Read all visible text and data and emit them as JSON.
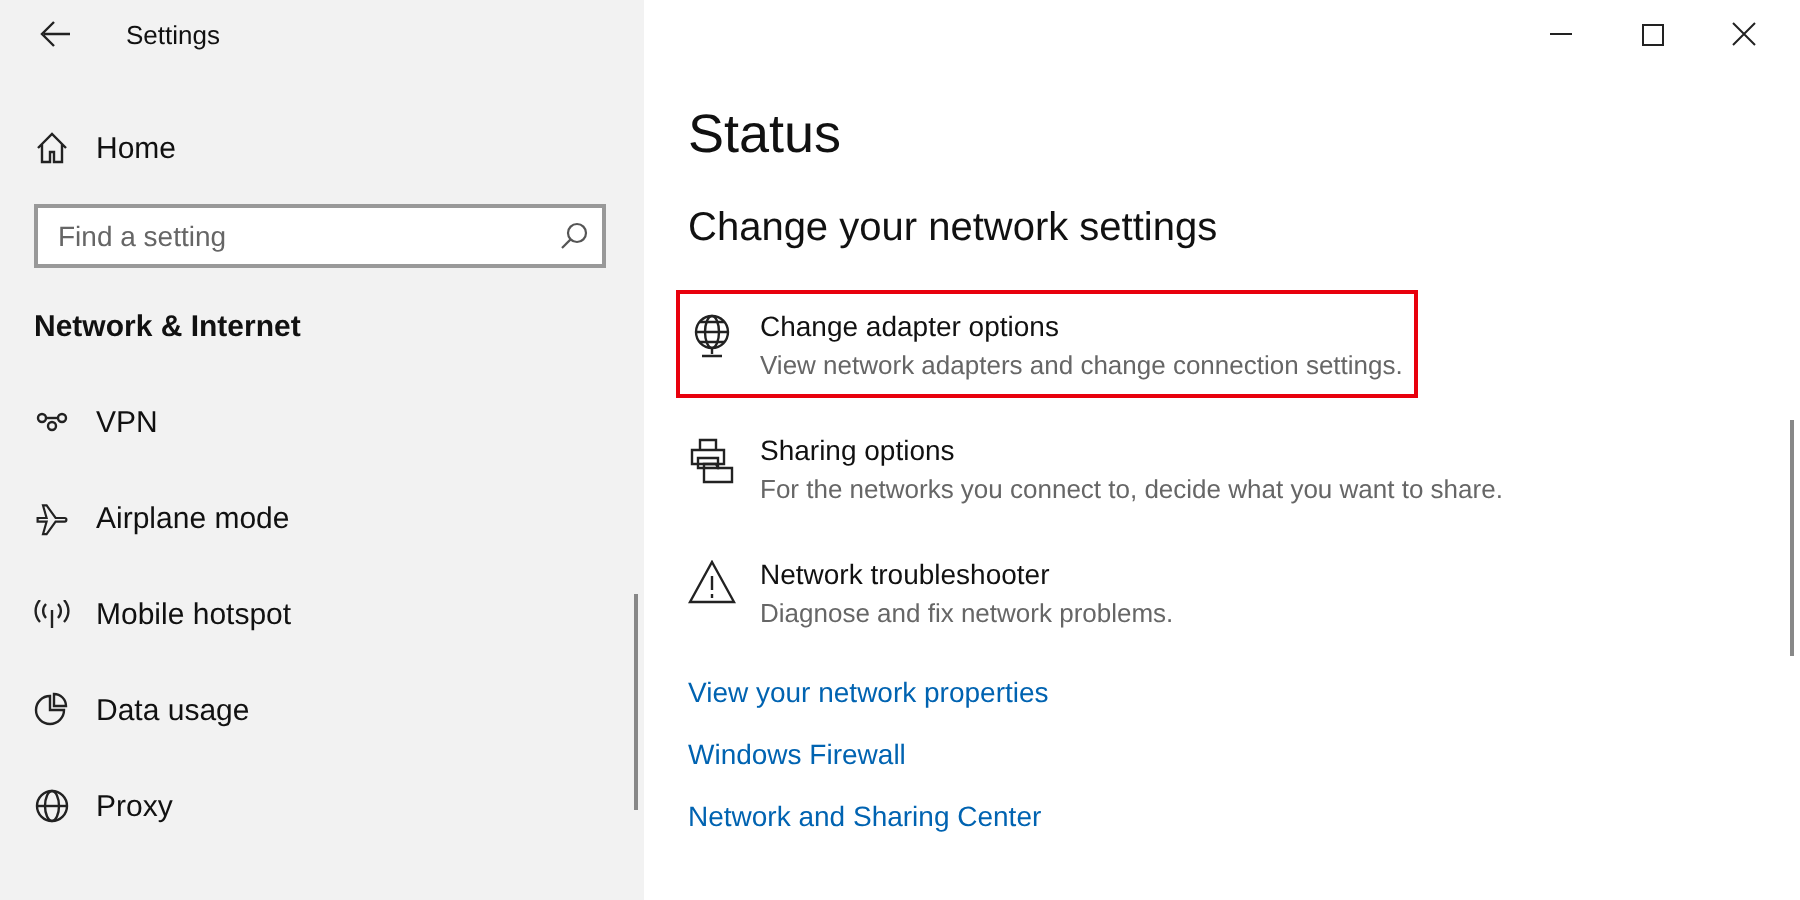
{
  "window": {
    "title": "Settings"
  },
  "sidebar": {
    "home": "Home",
    "search": {
      "placeholder": "Find a setting"
    },
    "section": "Network & Internet",
    "items": [
      {
        "label": "VPN",
        "kind": "vpn"
      },
      {
        "label": "Airplane mode",
        "kind": "airplane"
      },
      {
        "label": "Mobile hotspot",
        "kind": "hotspot"
      },
      {
        "label": "Data usage",
        "kind": "data"
      },
      {
        "label": "Proxy",
        "kind": "proxy"
      }
    ]
  },
  "main": {
    "title": "Status",
    "heading": "Change your network settings",
    "options": [
      {
        "title": "Change adapter options",
        "description": "View network adapters and change connection settings.",
        "kind": "adapter",
        "highlighted": true
      },
      {
        "title": "Sharing options",
        "description": "For the networks you connect to, decide what you want to share.",
        "kind": "sharing",
        "highlighted": false
      },
      {
        "title": "Network troubleshooter",
        "description": "Diagnose and fix network problems.",
        "kind": "troubleshooter",
        "highlighted": false
      }
    ],
    "links": [
      "View your network properties",
      "Windows Firewall",
      "Network and Sharing Center"
    ]
  }
}
